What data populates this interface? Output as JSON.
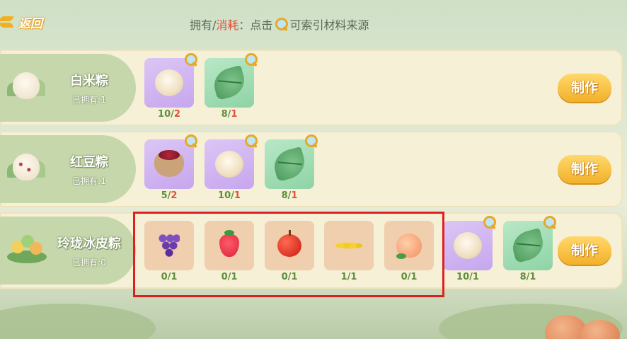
{
  "header": {
    "back_label": "返回",
    "hint_prefix": "拥有/",
    "hint_red": "消耗",
    "hint_mid": "：点击",
    "hint_suffix": "可索引材料来源"
  },
  "recipes": [
    {
      "name": "白米粽",
      "owned": "已拥有:1",
      "make_label": "制作",
      "materials": [
        {
          "icon": "rice-ball-icon",
          "have": "10",
          "need": "2"
        },
        {
          "icon": "leaf-icon",
          "have": "8",
          "need": "1"
        }
      ]
    },
    {
      "name": "红豆粽",
      "owned": "已拥有:1",
      "make_label": "制作",
      "materials": [
        {
          "icon": "red-bean-sack-icon",
          "have": "5",
          "need": "2"
        },
        {
          "icon": "rice-ball-icon",
          "have": "10",
          "need": "1"
        },
        {
          "icon": "leaf-icon",
          "have": "8",
          "need": "1"
        }
      ]
    },
    {
      "name": "玲珑冰皮粽",
      "owned": "已拥有:0",
      "make_label": "制作",
      "materials": [
        {
          "icon": "grape-icon",
          "have": "0",
          "need": "1"
        },
        {
          "icon": "strawberry-icon",
          "have": "0",
          "need": "1"
        },
        {
          "icon": "apple-icon",
          "have": "0",
          "need": "1"
        },
        {
          "icon": "banana-icon",
          "have": "1",
          "need": "1"
        },
        {
          "icon": "peach-icon",
          "have": "0",
          "need": "1"
        },
        {
          "icon": "rice-ball-icon",
          "have": "10",
          "need": "1"
        },
        {
          "icon": "leaf-icon",
          "have": "8",
          "need": "1"
        }
      ]
    }
  ],
  "colors": {
    "lack": "#e0503a",
    "ok": "#5f8e3e",
    "make_button": "#f2b12a",
    "highlight_box": "#e02020"
  }
}
